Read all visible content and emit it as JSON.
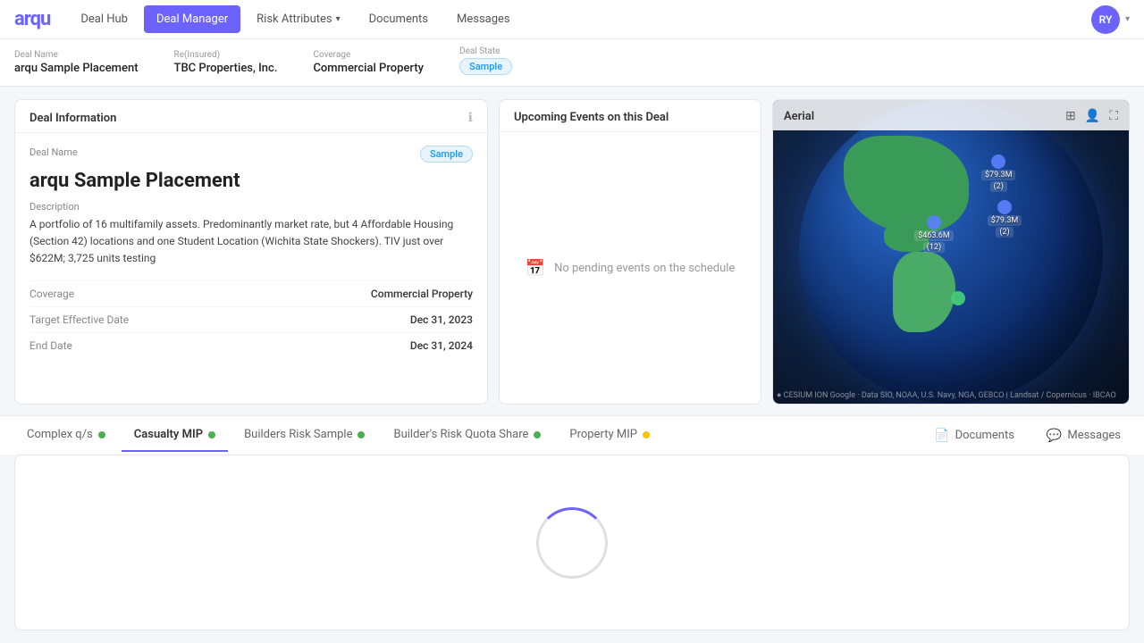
{
  "header": {
    "logo": "arqu",
    "nav": [
      {
        "id": "deal-hub",
        "label": "Deal Hub",
        "active": false,
        "hasChevron": false
      },
      {
        "id": "deal-manager",
        "label": "Deal Manager",
        "active": true,
        "hasChevron": false
      },
      {
        "id": "risk-attributes",
        "label": "Risk Attributes",
        "active": false,
        "hasChevron": true
      },
      {
        "id": "documents",
        "label": "Documents",
        "active": false,
        "hasChevron": false
      },
      {
        "id": "messages",
        "label": "Messages",
        "active": false,
        "hasChevron": false
      }
    ],
    "user": {
      "initials": "RY",
      "chevron": "▾"
    }
  },
  "deal_bar": {
    "deal_name_label": "Deal Name",
    "deal_name_value": "arqu Sample Placement",
    "reinsured_label": "Re(Insured)",
    "reinsured_value": "TBC Properties, Inc.",
    "coverage_label": "Coverage",
    "coverage_value": "Commercial Property",
    "deal_state_label": "Deal State",
    "deal_state_value": "Sample"
  },
  "deal_info_card": {
    "title": "Deal Information",
    "badge": "Sample",
    "deal_name_label": "Deal Name",
    "deal_title": "arqu Sample Placement",
    "description_label": "Description",
    "description": "A portfolio of 16 multifamily assets. Predominantly market rate, but 4 Affordable Housing (Section 42) locations and one Student Location (Wichita State Shockers). TIV just over $622M; 3,725 units testing",
    "coverage_label": "Coverage",
    "coverage_value": "Commercial Property",
    "target_date_label": "Target Effective Date",
    "target_date_value": "Dec 31, 2023",
    "end_date_label": "End Date",
    "end_date_value": "Dec 31, 2024"
  },
  "events_card": {
    "title": "Upcoming Events on this Deal",
    "empty_message": "No pending events on the schedule"
  },
  "aerial_card": {
    "title": "Aerial",
    "clusters": [
      {
        "id": "c1",
        "label": "$79.3M\n(2)",
        "type": "blue",
        "top": "22%",
        "left": "65%"
      },
      {
        "id": "c2",
        "label": "$463.6M\n(12)",
        "type": "blue",
        "top": "42%",
        "left": "50%"
      },
      {
        "id": "c3",
        "label": "$79.3M\n(2)",
        "type": "blue",
        "top": "38%",
        "left": "72%"
      },
      {
        "id": "c4",
        "label": "",
        "type": "green",
        "top": "68%",
        "left": "58%"
      }
    ],
    "cesium_credit": "● CESIUM ION  Google · Data SIO, NOAA, U.S. Navy, NGA, GEBCO | Landsat / Copernicus · IBCAO"
  },
  "tabs": {
    "items": [
      {
        "id": "complex-qs",
        "label": "Complex q/s",
        "dot_color": "green",
        "active": false
      },
      {
        "id": "casualty-mip",
        "label": "Casualty MIP",
        "dot_color": "green",
        "active": true
      },
      {
        "id": "builders-risk-sample",
        "label": "Builders Risk Sample",
        "dot_color": "green",
        "active": false
      },
      {
        "id": "builders-risk-quota-share",
        "label": "Builder's Risk Quota Share",
        "dot_color": "green",
        "active": false
      },
      {
        "id": "property-mip",
        "label": "Property MIP",
        "dot_color": "yellow",
        "active": false
      }
    ],
    "actions": [
      {
        "id": "documents-action",
        "label": "Documents",
        "icon": "📄"
      },
      {
        "id": "messages-action",
        "label": "Messages",
        "icon": "💬"
      }
    ]
  },
  "loading": {
    "visible": true
  }
}
